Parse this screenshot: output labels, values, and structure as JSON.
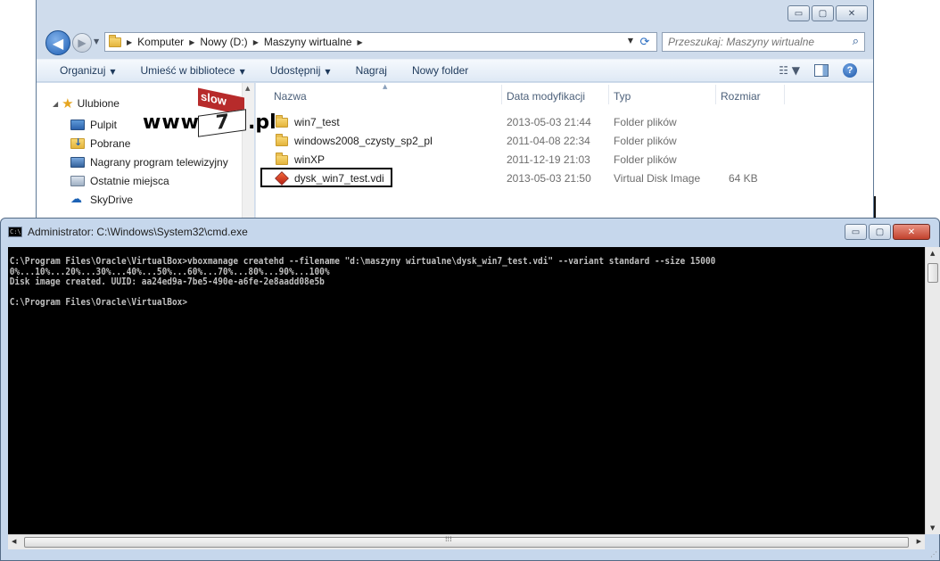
{
  "explorer": {
    "caption": {
      "minimize": "▭",
      "maximize": "▢",
      "close": "✕"
    },
    "nav": {
      "back": "◀",
      "forward": "▶",
      "history": "▼"
    },
    "breadcrumb": [
      "Komputer",
      "Nowy (D:)",
      "Maszyny wirtualne"
    ],
    "breadcrumb_sep": "▶",
    "address_dropdown": "▼",
    "refresh": "⟳",
    "search": {
      "placeholder": "Przeszukaj: Maszyny wirtualne",
      "icon": "⌕"
    },
    "toolbar": {
      "organize": "Organizuj",
      "include_in_library": "Umieść w bibliotece",
      "share": "Udostępnij",
      "burn": "Nagraj",
      "new_folder": "Nowy folder",
      "caret": "▼",
      "view_icon": "☷ ▼",
      "help": "?"
    },
    "nav_pane": {
      "favorites_label": "Ulubione",
      "favorites_icon": "★",
      "expand": "◢",
      "items": [
        {
          "label": "Pulpit",
          "icon": "desktop-icon"
        },
        {
          "label": "Pobrane",
          "icon": "downloads-icon"
        },
        {
          "label": "Nagrany program telewizyjny",
          "icon": "recorded-tv-icon"
        },
        {
          "label": "Ostatnie miejsca",
          "icon": "recent-places-icon"
        },
        {
          "label": "SkyDrive",
          "icon": "skydrive-icon"
        }
      ],
      "skydrive_glyph": "☁",
      "scroll_up": "▲"
    },
    "columns": {
      "name": "Nazwa",
      "modified": "Data modyfikacji",
      "type": "Typ",
      "size": "Rozmiar",
      "sort": "▲"
    },
    "files": [
      {
        "name": "win7_test",
        "modified": "2013-05-03 21:44",
        "type": "Folder plików",
        "size": "",
        "kind": "folder"
      },
      {
        "name": "windows2008_czysty_sp2_pl",
        "modified": "2011-04-08 22:34",
        "type": "Folder plików",
        "size": "",
        "kind": "folder"
      },
      {
        "name": "winXP",
        "modified": "2011-12-19 21:03",
        "type": "Folder plików",
        "size": "",
        "kind": "folder"
      },
      {
        "name": "dysk_win7_test.vdi",
        "modified": "2013-05-03 21:50",
        "type": "Virtual Disk Image",
        "size": "64 KB",
        "kind": "vdi"
      }
    ]
  },
  "watermark": {
    "www": "www.",
    "tag": "slow",
    "num": "7",
    "pl": ".pl"
  },
  "cmd": {
    "title": "Administrator: C:\\Windows\\System32\\cmd.exe",
    "icon_text": "C:\\",
    "caption": {
      "minimize": "▭",
      "maximize": "▢",
      "close": "✕"
    },
    "lines": [
      "C:\\Program Files\\Oracle\\VirtualBox>vboxmanage createhd --filename \"d:\\maszyny wirtualne\\dysk_win7_test.vdi\" --variant standard --size 15000",
      "0%...10%...20%...30%...40%...50%...60%...70%...80%...90%...100%",
      "Disk image created. UUID: aa24ed9a-7be5-490e-a6fe-2e8aadd08e5b",
      "",
      "C:\\Program Files\\Oracle\\VirtualBox>"
    ],
    "scroll": {
      "up": "▲",
      "down": "▼",
      "left": "◀",
      "right": "▶",
      "grip": "⁞⁞⁞",
      "size_grip": "⋰"
    }
  }
}
